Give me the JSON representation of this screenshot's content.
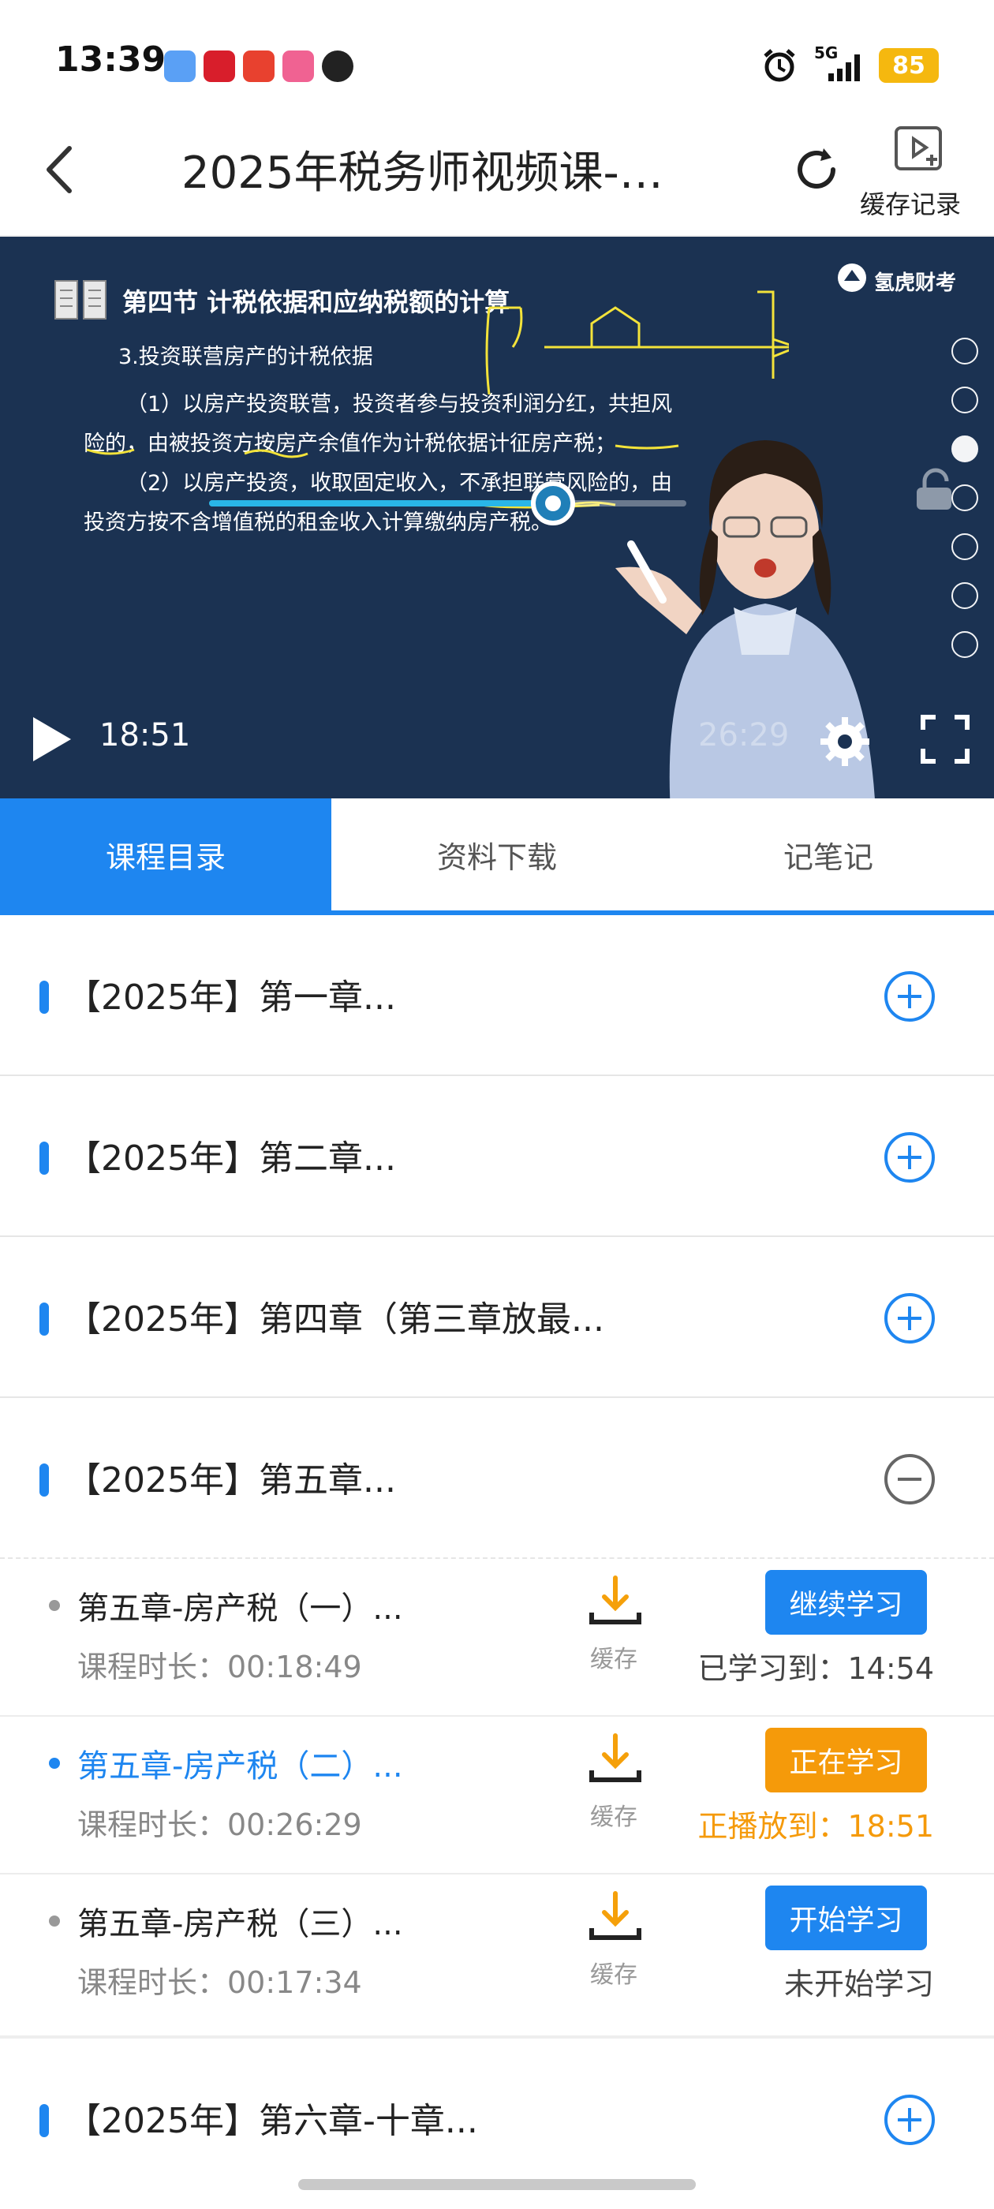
{
  "status_bar": {
    "time": "13:39",
    "network": "5G",
    "battery": "85"
  },
  "header": {
    "title": "2025年税务师视频课-…",
    "cache_label": "缓存记录"
  },
  "video": {
    "slide_title": "第四节  计税依据和应纳税额的计算",
    "slide_lines": [
      "3.投资联营房产的计税依据",
      "（1）以房产投资联营，投资者参与投资利润分红，共担风",
      "险的，由被投资方按房产余值作为计税依据计征房产税；",
      "（2）以房产投资，收取固定收入，不承担联营风险的，由",
      "投资方按不含增值税的租金收入计算缴纳房产税。"
    ],
    "brand": "氢虎财考",
    "current_time": "18:51",
    "total_time": "26:29",
    "progress": 0.72
  },
  "tabs": [
    {
      "label": "课程目录",
      "active": true
    },
    {
      "label": "资料下载",
      "active": false
    },
    {
      "label": "记笔记",
      "active": false
    }
  ],
  "chapters": [
    {
      "label": "【2025年】第一章..."
    },
    {
      "label": "【2025年】第二章..."
    },
    {
      "label": "【2025年】第四章（第三章放最..."
    },
    {
      "label": "【2025年】第五章..."
    },
    {
      "label": "【2025年】第六章-十章..."
    }
  ],
  "lessons": [
    {
      "name": "第五章-房产税（一）...",
      "duration": "课程时长：00:18:49",
      "download": "缓存",
      "button": "继续学习",
      "progress": "已学习到：14:54"
    },
    {
      "name": "第五章-房产税（二）...",
      "duration": "课程时长：00:26:29",
      "download": "缓存",
      "button": "正在学习",
      "progress": "正播放到：18:51"
    },
    {
      "name": "第五章-房产税（三）...",
      "duration": "课程时长：00:17:34",
      "download": "缓存",
      "button": "开始学习",
      "progress": "未开始学习"
    }
  ],
  "colors": {
    "accent": "#1e86f0",
    "playing": "#f59a0a",
    "battery": "#f5b80f",
    "video_bg": "#1b3252"
  }
}
